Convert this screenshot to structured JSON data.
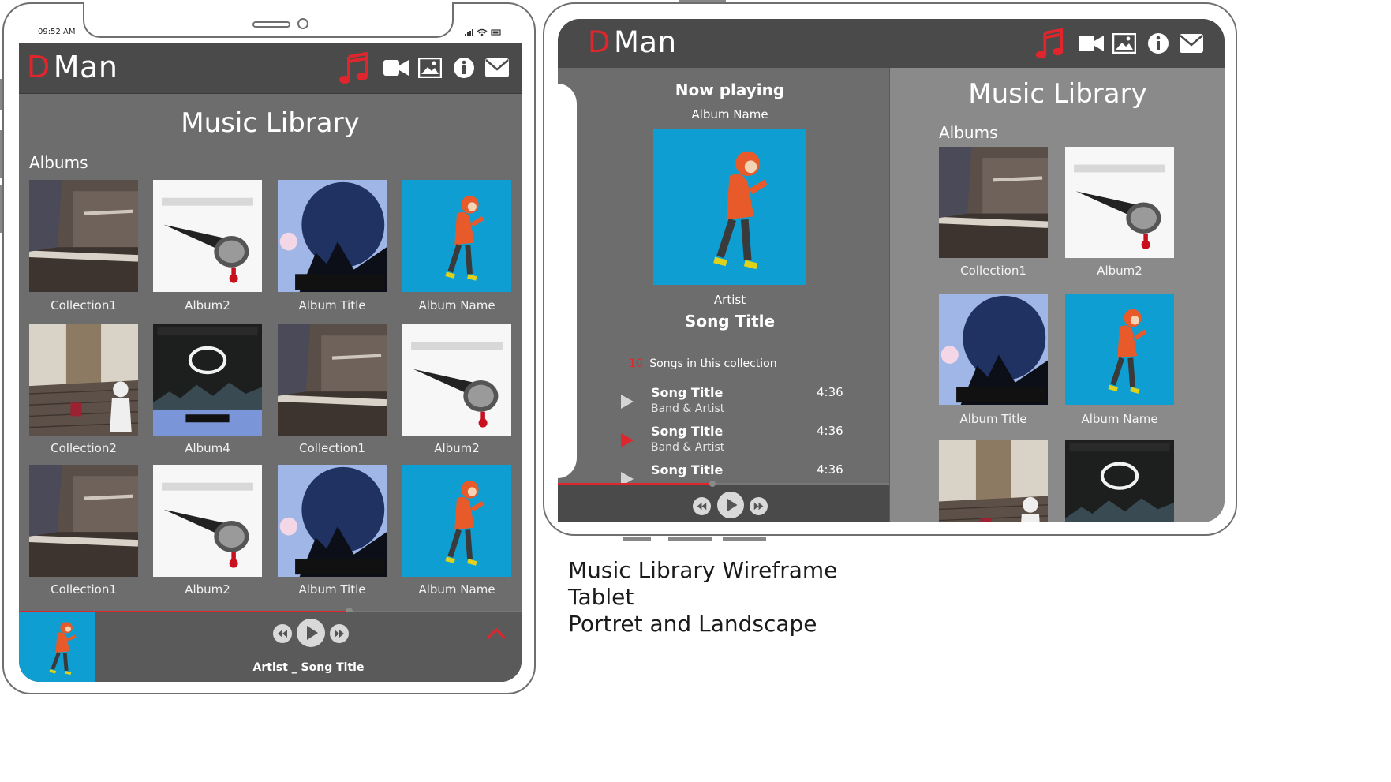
{
  "portrait": {
    "status_time": "09:52 AM",
    "brand_d": "D",
    "brand_rest": "Man",
    "page_title": "Music Library",
    "section": "Albums",
    "albums": [
      {
        "label": "Collection1",
        "art": "piano"
      },
      {
        "label": "Album2",
        "art": "mic"
      },
      {
        "label": "Album Title",
        "art": "vineri"
      },
      {
        "label": "Album Name",
        "art": "walker"
      },
      {
        "label": "Collection2",
        "art": "stairs"
      },
      {
        "label": "Album4",
        "art": "ingeri"
      },
      {
        "label": "Collection1",
        "art": "piano"
      },
      {
        "label": "Album2",
        "art": "mic"
      },
      {
        "label": "Collection1",
        "art": "piano"
      },
      {
        "label": "Album2",
        "art": "mic"
      },
      {
        "label": "Album Title",
        "art": "vineri"
      },
      {
        "label": "Album Name",
        "art": "walker"
      }
    ],
    "player": {
      "now_text": "Artist _ Song Title"
    }
  },
  "landscape": {
    "brand_d": "D",
    "brand_rest": "Man",
    "now_playing_heading": "Now playing",
    "album_name": "Album Name",
    "artist": "Artist",
    "song_title": "Song Title",
    "collection_count": "10",
    "collection_count_label": "Songs in this collection",
    "tracks": [
      {
        "title": "Song Title",
        "band": "Band & Artist",
        "duration": "4:36",
        "active": false
      },
      {
        "title": "Song Title",
        "band": "Band & Artist",
        "duration": "4:36",
        "active": true
      },
      {
        "title": "Song Title",
        "band": "",
        "duration": "4:36",
        "active": false
      }
    ],
    "page_title": "Music Library",
    "section": "Albums",
    "albums": [
      {
        "label": "Collection1",
        "art": "piano"
      },
      {
        "label": "Album2",
        "art": "mic"
      },
      {
        "label": "Album Title",
        "art": "vineri"
      },
      {
        "label": "Album Name",
        "art": "walker"
      },
      {
        "label": "",
        "art": "stairs"
      },
      {
        "label": "",
        "art": "ingeri"
      }
    ]
  },
  "caption": {
    "line1": "Music Library Wireframe",
    "line2": "Tablet",
    "line3": "Portret and Landscape"
  },
  "icons": [
    "music-note-icon",
    "video-camera-icon",
    "image-icon",
    "info-icon",
    "mail-icon"
  ],
  "colors": {
    "accent": "#e0262d",
    "screen": "#6d6d6d",
    "header": "#4a4a4a",
    "panel_right": "#8a8a8a",
    "cover_blue": "#0f9ed1"
  }
}
